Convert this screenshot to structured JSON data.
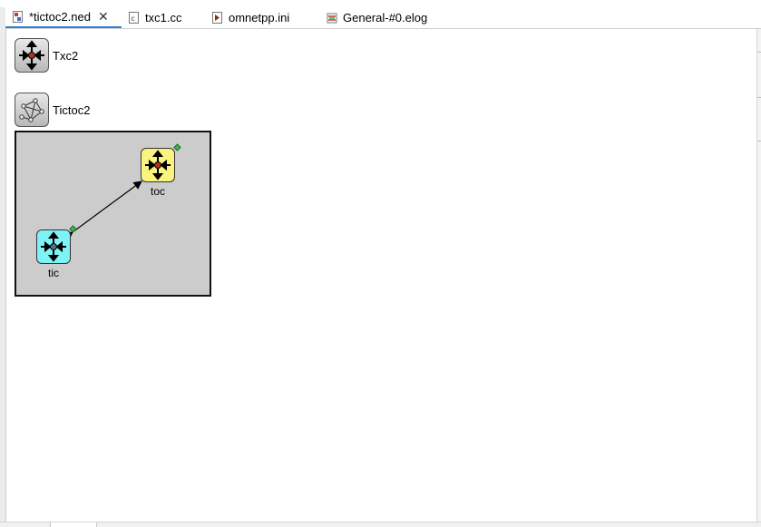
{
  "tabs": [
    {
      "label": "*tictoc2.ned",
      "icon": "ned-file-icon",
      "active": true,
      "closable": true
    },
    {
      "label": "txc1.cc",
      "icon": "cpp-file-icon",
      "active": false,
      "closable": false
    },
    {
      "label": "omnetpp.ini",
      "icon": "ini-file-icon",
      "active": false,
      "closable": false
    },
    {
      "label": "General-#0.elog",
      "icon": "elog-file-icon",
      "active": false,
      "closable": false
    }
  ],
  "tab_close_glyph": "✕",
  "types": [
    {
      "name": "Txc2",
      "icon": "simple-module-icon"
    },
    {
      "name": "Tictoc2",
      "icon": "network-icon"
    }
  ],
  "network": {
    "submodules": [
      {
        "name": "toc",
        "color": "#f8f47e"
      },
      {
        "name": "tic",
        "color": "#7ff2f5"
      }
    ],
    "connection": "bidirectional"
  },
  "colors": {
    "accent": "#2f7fd6",
    "network_bg": "#cccccc"
  }
}
